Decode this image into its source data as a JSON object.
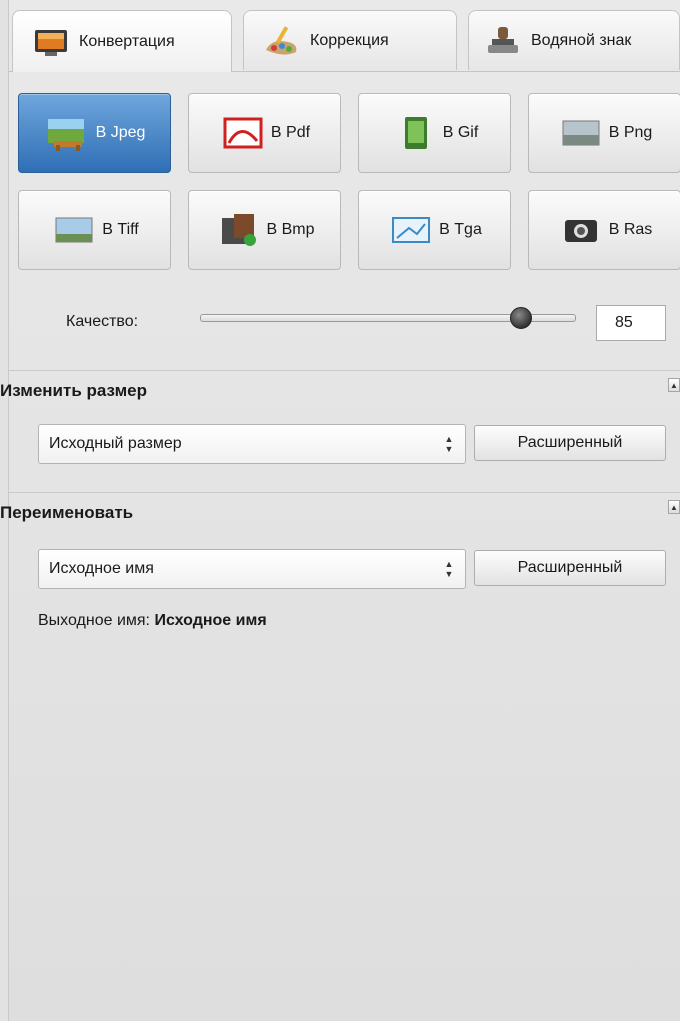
{
  "tabs": [
    {
      "label": "Конвертация",
      "icon": "monitor-icon",
      "active": true
    },
    {
      "label": "Коррекция",
      "icon": "brush-palette-icon",
      "active": false
    },
    {
      "label": "Водяной знак",
      "icon": "stamp-icon",
      "active": false
    }
  ],
  "formats": [
    {
      "label": "В Jpeg",
      "icon": "jpeg-photo-icon",
      "active": true
    },
    {
      "label": "В Pdf",
      "icon": "pdf-icon",
      "active": false
    },
    {
      "label": "В Gif",
      "icon": "gif-icon",
      "active": false
    },
    {
      "label": "В Png",
      "icon": "png-icon",
      "active": false
    },
    {
      "label": "В Tiff",
      "icon": "tiff-icon",
      "active": false
    },
    {
      "label": "В Bmp",
      "icon": "bmp-icon",
      "active": false
    },
    {
      "label": "В Tga",
      "icon": "tga-icon",
      "active": false
    },
    {
      "label": "В Ras",
      "icon": "ras-camera-icon",
      "active": false
    }
  ],
  "quality": {
    "label": "Качество:",
    "value": "85",
    "level": 85
  },
  "resize": {
    "title": "Изменить размер",
    "selected": "Исходный размер",
    "advanced_label": "Расширенный"
  },
  "rename": {
    "title": "Переименовать",
    "selected": "Исходное имя",
    "advanced_label": "Расширенный",
    "output_label": "Выходное имя:",
    "output_value": "Исходное имя"
  },
  "colors": {
    "accent": "#2f6fb6",
    "background": "#e2e2e2"
  }
}
